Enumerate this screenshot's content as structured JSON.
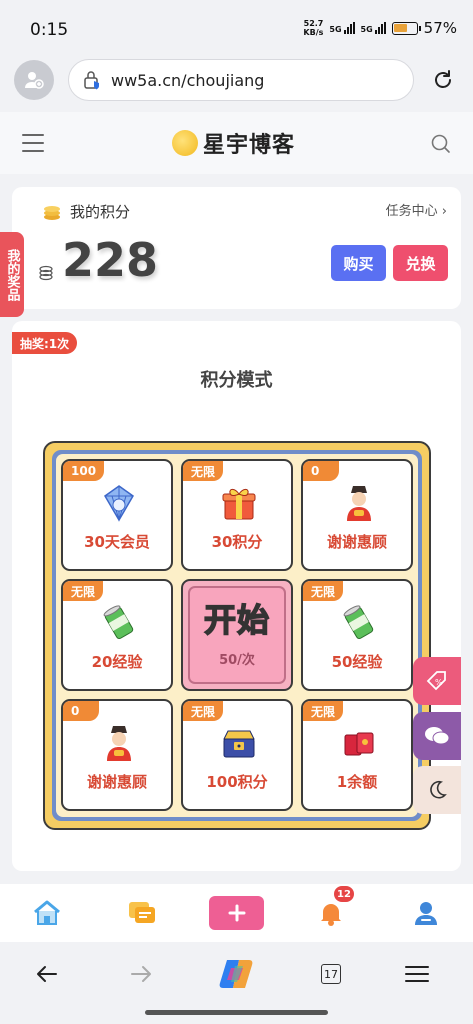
{
  "status": {
    "time": "0:15",
    "speed_top": "52.7",
    "speed_bottom": "KB/s",
    "net1": "5G",
    "net2": "5G",
    "battery": "57%"
  },
  "browser": {
    "url": "ww5a.cn/choujiang",
    "tab_count": "17"
  },
  "site": {
    "brand": "星宇博客"
  },
  "points": {
    "title": "我的积分",
    "task_link": "任务中心 ›",
    "value": "228",
    "buy_label": "购买",
    "exchange_label": "兑换"
  },
  "side_tab": "我的奖品",
  "lottery": {
    "draw_badge": "抽奖:1次",
    "mode_title": "积分模式",
    "start_label": "开始",
    "start_cost": "50/次",
    "cells": [
      {
        "tag": "100",
        "label": "30天会员",
        "icon": "diamond-badge-icon"
      },
      {
        "tag": "无限",
        "label": "30积分",
        "icon": "gift-box-icon"
      },
      {
        "tag": "0",
        "label": "谢谢惠顾",
        "icon": "fortune-god-icon"
      },
      {
        "tag": "无限",
        "label": "20经验",
        "icon": "green-can-icon"
      },
      {
        "tag": "无限",
        "label": "50经验",
        "icon": "green-can-icon"
      },
      {
        "tag": "0",
        "label": "谢谢惠顾",
        "icon": "fortune-god-icon"
      },
      {
        "tag": "无限",
        "label": "100积分",
        "icon": "treasure-box-icon"
      },
      {
        "tag": "无限",
        "label": "1余额",
        "icon": "red-envelope-icon"
      }
    ]
  },
  "notifications": {
    "count": "12"
  },
  "colors": {
    "buy": "#5a70f2",
    "exchange": "#ef4f6e",
    "tag": "#f08a36",
    "prize_text": "#d84a35",
    "board_frame": "#f5cd63",
    "board_inner": "#6f8dc9"
  }
}
